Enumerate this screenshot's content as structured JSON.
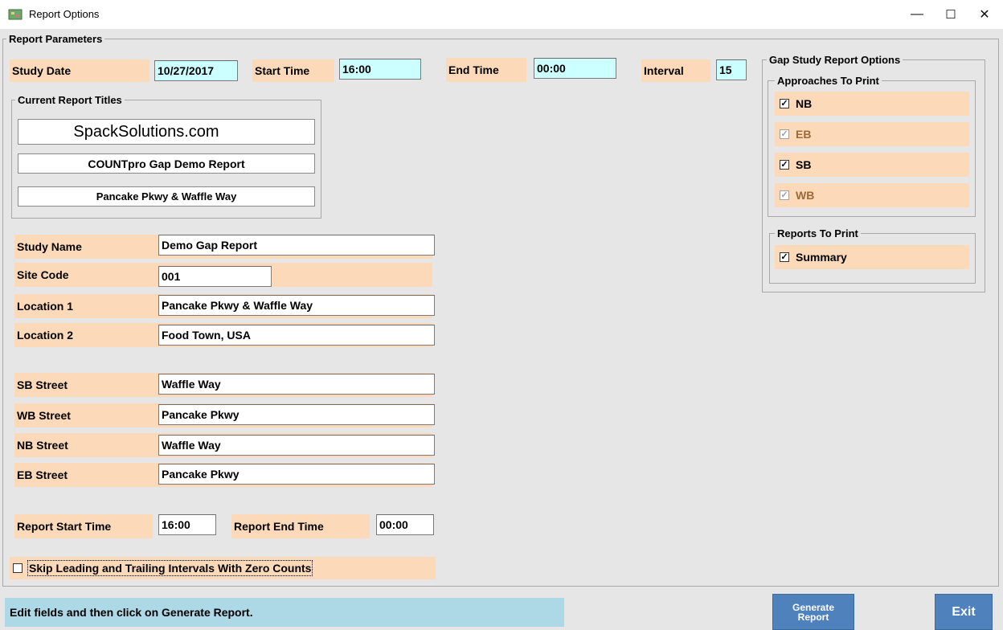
{
  "window": {
    "title": "Report Options",
    "icon": "app-icon",
    "controls": {
      "minimize": "—",
      "maximize": "☐",
      "close": "✕"
    }
  },
  "parameters": {
    "frame_title": "Report Parameters",
    "study_date": {
      "label": "Study Date",
      "value": "10/27/2017"
    },
    "start_time": {
      "label": "Start Time",
      "value": "16:00"
    },
    "end_time": {
      "label": "End Time",
      "value": "00:00"
    },
    "interval": {
      "label": "Interval",
      "value": "15"
    }
  },
  "report_titles": {
    "frame_title": "Current Report Titles",
    "title1": "SpackSolutions.com",
    "title2": "COUNTpro Gap Demo Report",
    "title3": "Pancake Pkwy & Waffle Way"
  },
  "study": {
    "study_name": {
      "label": "Study Name",
      "value": "Demo Gap Report"
    },
    "site_code": {
      "label": "Site Code",
      "value": "001"
    },
    "location1": {
      "label": "Location 1",
      "value": "Pancake Pkwy & Waffle Way"
    },
    "location2": {
      "label": "Location 2",
      "value": "Food Town, USA"
    }
  },
  "streets": {
    "sb": {
      "label": "SB Street",
      "value": "Waffle Way"
    },
    "wb": {
      "label": "WB Street",
      "value": "Pancake Pkwy"
    },
    "nb": {
      "label": "NB Street",
      "value": "Waffle Way"
    },
    "eb": {
      "label": "EB Street",
      "value": "Pancake Pkwy"
    }
  },
  "report_times": {
    "start": {
      "label": "Report Start Time",
      "value": "16:00"
    },
    "end": {
      "label": "Report End Time",
      "value": "00:00"
    }
  },
  "skip_zero": {
    "label": "Skip Leading and Trailing Intervals With Zero Counts",
    "checked": false
  },
  "gap_options": {
    "frame_title": "Gap Study Report Options",
    "approaches_title": "Approaches To Print",
    "approaches": [
      {
        "label": "NB",
        "checked": true,
        "enabled": true
      },
      {
        "label": "EB",
        "checked": true,
        "enabled": false
      },
      {
        "label": "SB",
        "checked": true,
        "enabled": true
      },
      {
        "label": "WB",
        "checked": true,
        "enabled": false
      }
    ],
    "reports_title": "Reports To Print",
    "reports": [
      {
        "label": "Summary",
        "checked": true,
        "enabled": true
      }
    ]
  },
  "status": {
    "text": "Edit fields and then click on Generate Report."
  },
  "buttons": {
    "generate": "Generate Report",
    "exit": "Exit"
  },
  "check_mark": "✓",
  "colors": {
    "label_bg": "#fcd9b8",
    "time_field_bg": "#ccffff",
    "button": "#4f81bd",
    "status_bg": "#add8e6"
  }
}
